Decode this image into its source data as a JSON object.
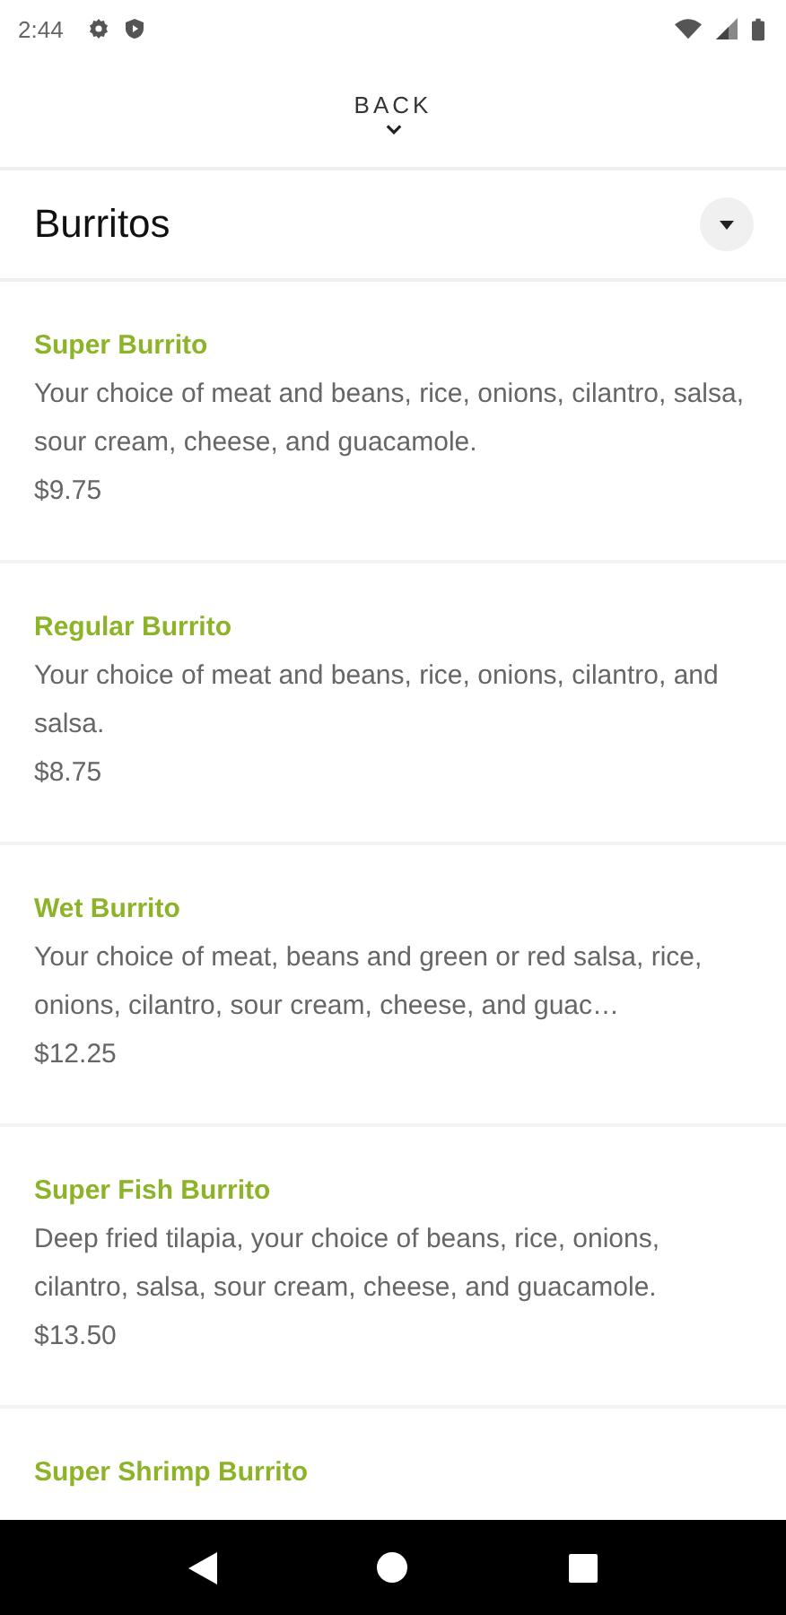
{
  "status_bar": {
    "time": "2:44"
  },
  "header": {
    "back_label": "BACK"
  },
  "category": {
    "title": "Burritos",
    "expanded": false
  },
  "items": [
    {
      "name": "Super Burrito",
      "description": "Your choice of meat and beans, rice, onions, cilantro, salsa, sour cream, cheese, and guacamole.",
      "price": "$9.75"
    },
    {
      "name": "Regular Burrito",
      "description": "Your choice of meat and beans, rice, onions, cilantro, and salsa.",
      "price": "$8.75"
    },
    {
      "name": "Wet Burrito",
      "description": "Your choice of meat, beans and green or red salsa, rice, onions, cilantro, sour cream, cheese, and guac…",
      "price": "$12.25"
    },
    {
      "name": "Super Fish Burrito",
      "description": "Deep fried tilapia, your choice of beans, rice, onions, cilantro, salsa, sour cream, cheese, and guacamole.",
      "price": "$13.50"
    },
    {
      "name": "Super Shrimp Burrito"
    }
  ]
}
